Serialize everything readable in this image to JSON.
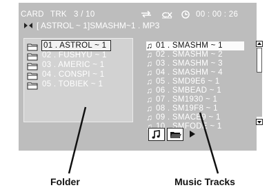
{
  "status_bar": {
    "source": "CARD",
    "track_label": "TRK",
    "track_position": "3 / 10",
    "elapsed_time": "00 : 00 : 26"
  },
  "path_bar": {
    "path": "[ ASTROL ~ 1]SMASHM~1 . MP3"
  },
  "folders": [
    {
      "label": "01 . ASTROL ~ 1",
      "selected": true
    },
    {
      "label": "02 . FUSHYU ~ 1",
      "selected": false
    },
    {
      "label": "03 . AMERIC ~ 1",
      "selected": false
    },
    {
      "label": "04 . CONSPI ~ 1",
      "selected": false
    },
    {
      "label": "05 . TOBIEK ~ 1",
      "selected": false
    }
  ],
  "tracks": [
    {
      "label": "01 . SMASHM ~ 1",
      "selected": true
    },
    {
      "label": "02 . SMASHM ~ 2",
      "selected": false
    },
    {
      "label": "03 . SMASHM ~ 3",
      "selected": false
    },
    {
      "label": "04 . SMASHM ~ 4",
      "selected": false
    },
    {
      "label": "05 . SMD9E6 ~ 1",
      "selected": false
    },
    {
      "label": "06 . SMBEAD ~ 1",
      "selected": false
    },
    {
      "label": "07 . SM1930 ~ 1",
      "selected": false
    },
    {
      "label": "08 . SM19F8 ~ 1",
      "selected": false
    },
    {
      "label": "09 . SMACE9 ~ 1",
      "selected": false
    },
    {
      "label": "10 . SMFODE ~ 1",
      "selected": false
    }
  ],
  "icons": {
    "folder": "folder-icon",
    "track": "music-note-icon",
    "repeat": "repeat-icon",
    "random": "random-icon",
    "clock": "clock-icon",
    "path": "bowtie-icon",
    "play": "play-arrow-icon"
  },
  "captions": {
    "folder": "Folder",
    "tracks": "Music Tracks"
  },
  "colors": {
    "screen": "#bdbdbd",
    "folder_pane": "#d2d2d2",
    "highlight": "#ffffff",
    "text": "#ffffff"
  }
}
